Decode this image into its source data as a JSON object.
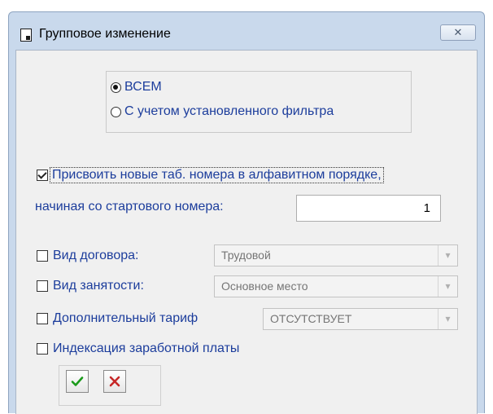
{
  "window": {
    "title": "Групповое изменение",
    "close_glyph": "✕"
  },
  "scope": {
    "options": [
      {
        "label": "ВСЕМ",
        "selected": true
      },
      {
        "label": "С учетом установленного фильтра",
        "selected": false
      }
    ]
  },
  "renumber": {
    "checkbox_label": "Присвоить новые таб. номера в алфавитном порядке,",
    "checked": true,
    "start_label": "начиная со стартового номера:",
    "start_value": "1"
  },
  "contract_type": {
    "label": "Вид договора:",
    "checked": false,
    "value": "Трудовой"
  },
  "employment_type": {
    "label": "Вид занятости:",
    "checked": false,
    "value": "Основное место"
  },
  "extra_tariff": {
    "label": "Дополнительный тариф",
    "checked": false,
    "value": "ОТСУТСТВУЕТ"
  },
  "salary_indexation": {
    "label": "Индексация заработной платы",
    "checked": false
  },
  "buttons": {
    "ok_icon": "check-icon",
    "cancel_icon": "cross-icon",
    "ok_color": "#1a9a1a",
    "cancel_color": "#c62828"
  }
}
